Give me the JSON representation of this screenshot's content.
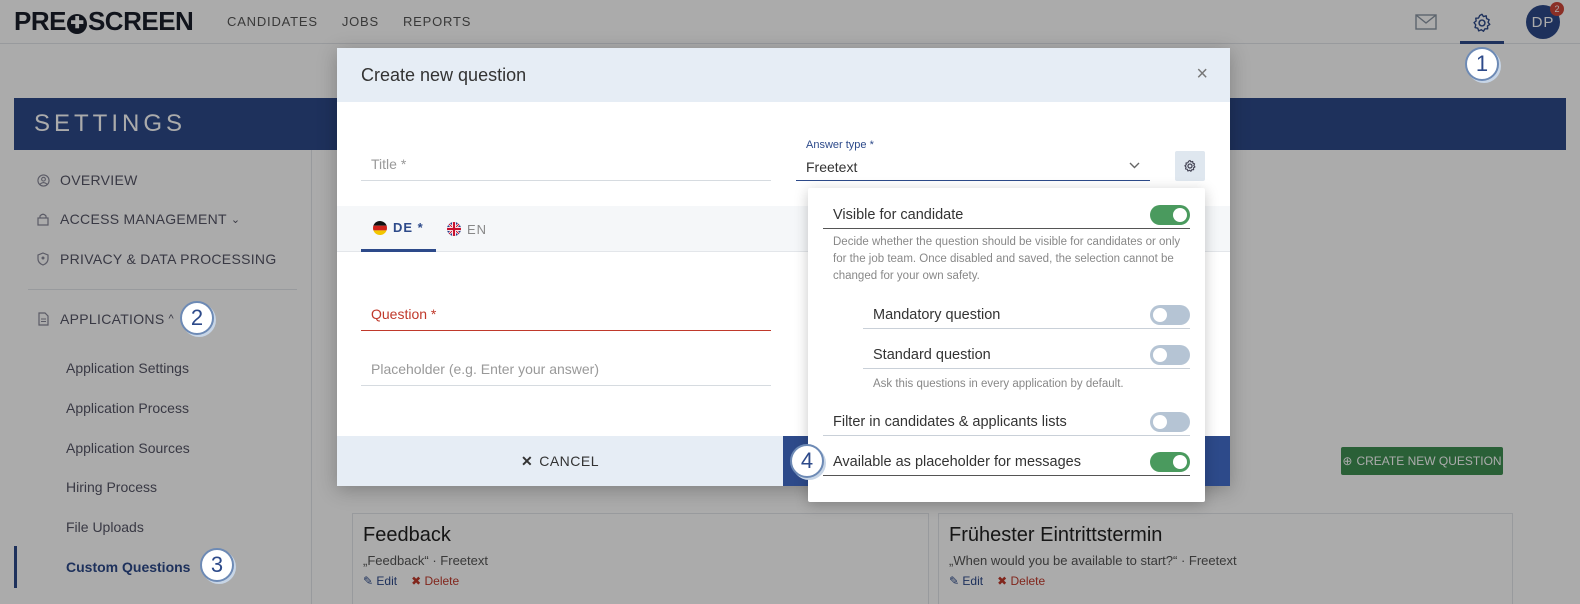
{
  "app": {
    "logo_left": "PRE",
    "logo_right": "SCREEN",
    "nav": [
      "CANDIDATES",
      "JOBS",
      "REPORTS"
    ],
    "avatar_initials": "DP",
    "notification_count": "2"
  },
  "settings": {
    "title": "SETTINGS"
  },
  "sidebar": {
    "items": [
      {
        "label": "OVERVIEW",
        "icon": "user-circle-icon"
      },
      {
        "label": "ACCESS MANAGEMENT",
        "icon": "lock-icon",
        "suffix": "⌄"
      },
      {
        "label": "PRIVACY & DATA PROCESSING",
        "icon": "shield-person-icon"
      },
      {
        "label": "APPLICATIONS",
        "icon": "document-icon",
        "suffix": "^"
      }
    ],
    "sub_items": [
      "Application Settings",
      "Application Process",
      "Application Sources",
      "Hiring Process",
      "File Uploads",
      "Custom Questions"
    ]
  },
  "content": {
    "create_button": "CREATE NEW QUESTION",
    "cards": [
      {
        "title": "Feedback",
        "subtitle": "„Feedback“ · Freetext",
        "edit": "Edit",
        "delete": "Delete"
      },
      {
        "title": "Frühester Eintrittstermin",
        "subtitle": "„When would you be available to start?“ · Freetext",
        "edit": "Edit",
        "delete": "Delete"
      }
    ]
  },
  "modal": {
    "title": "Create new question",
    "title_placeholder": "Title *",
    "answer_type_label": "Answer type *",
    "answer_type_value": "Freetext",
    "tabs": [
      {
        "label": "DE *",
        "active": true
      },
      {
        "label": "EN",
        "active": false
      }
    ],
    "question_placeholder": "Question *",
    "placeholder_field": "Placeholder (e.g. Enter your answer)",
    "cancel_label": "CANCEL"
  },
  "popover": {
    "visible_label": "Visible for candidate",
    "visible_help": "Decide whether the question should be visible for candidates or only for the job team. Once disabled and saved, the selection cannot be changed for your own safety.",
    "mandatory_label": "Mandatory question",
    "standard_label": "Standard question",
    "standard_help": "Ask this questions in every application by default.",
    "filter_label": "Filter in candidates & applicants lists",
    "placeholder_label": "Available as placeholder for messages",
    "toggles": {
      "visible": true,
      "mandatory": false,
      "standard": false,
      "filter": false,
      "placeholder": true
    }
  },
  "steps": [
    "1",
    "2",
    "3",
    "4"
  ],
  "colors": {
    "primary": "#2d4a8a",
    "success": "#4a9a5e",
    "danger": "#c0392b"
  }
}
